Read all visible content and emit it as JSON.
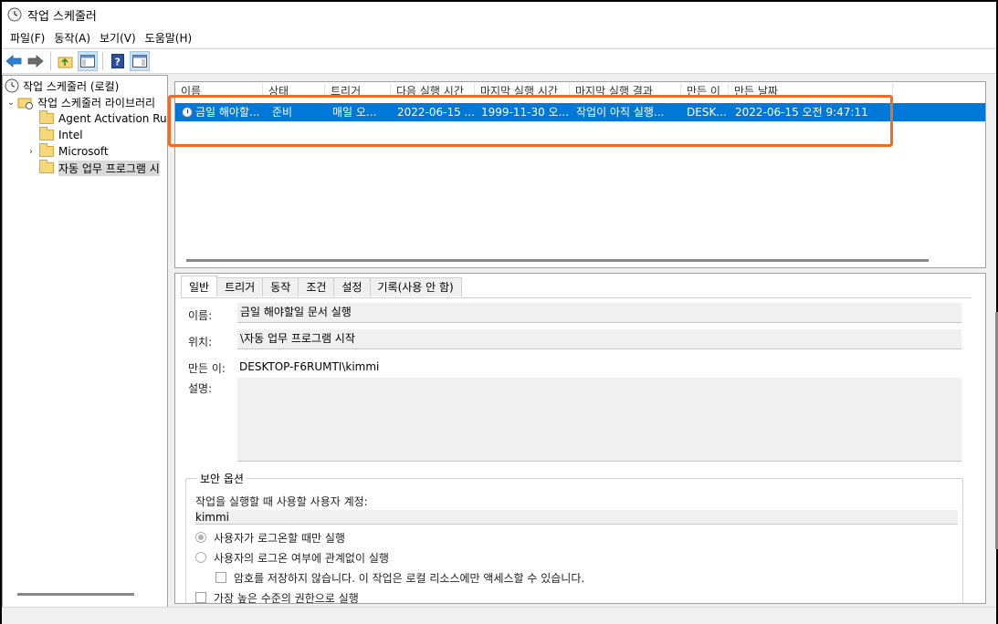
{
  "window": {
    "title": "작업 스케줄러"
  },
  "menu": [
    "파일(F)",
    "동작(A)",
    "보기(V)",
    "도움말(H)"
  ],
  "tree": {
    "root": "작업 스케줄러 (로컬)",
    "library": "작업 스케줄러 라이브러리",
    "items": [
      "Agent Activation Runt",
      "Intel",
      "Microsoft",
      "자동 업무 프로그램 시"
    ]
  },
  "task_list": {
    "columns": [
      "이름",
      "상태",
      "트리거",
      "다음 실행 시간",
      "마지막 실행 시간",
      "마지막 실행 결과",
      "만든 이",
      "만든 날짜"
    ],
    "rows": [
      {
        "name": "금일 해야할...",
        "status": "준비",
        "trigger": "매일 오...",
        "next_run": "2022-06-15 ...",
        "last_run": "1999-11-30 오...",
        "last_result": "작업이 아직 실행...",
        "author": "DESK...",
        "created": "2022-06-15 오전 9:47:11"
      }
    ]
  },
  "details": {
    "tabs": [
      "일반",
      "트리거",
      "동작",
      "조건",
      "설정",
      "기록(사용 안 함)"
    ],
    "name_label": "이름:",
    "name_value": "금일 해야할일 문서 실행",
    "location_label": "위치:",
    "location_value": "\\자동 업무 프로그램 시작",
    "author_label": "만든 이:",
    "author_value": "DESKTOP-F6RUMTI\\kimmi",
    "description_label": "설명:",
    "security": {
      "title": "보안 옵션",
      "account_label": "작업을 실행할 때 사용할 사용자 계정:",
      "account_value": "kimmi",
      "option_logged_on": "사용자가 로그온할 때만 실행",
      "option_whether": "사용자의 로그온 여부에 관계없이 실행",
      "option_no_password": "암호를 저장하지 않습니다. 이 작업은 로컬 리소스에만 액세스할 수 있습니다.",
      "option_highest": "가장 높은 수준의 권한으로 실행"
    }
  },
  "colors": {
    "selection": "#0078d7",
    "highlight": "#f26b21"
  }
}
